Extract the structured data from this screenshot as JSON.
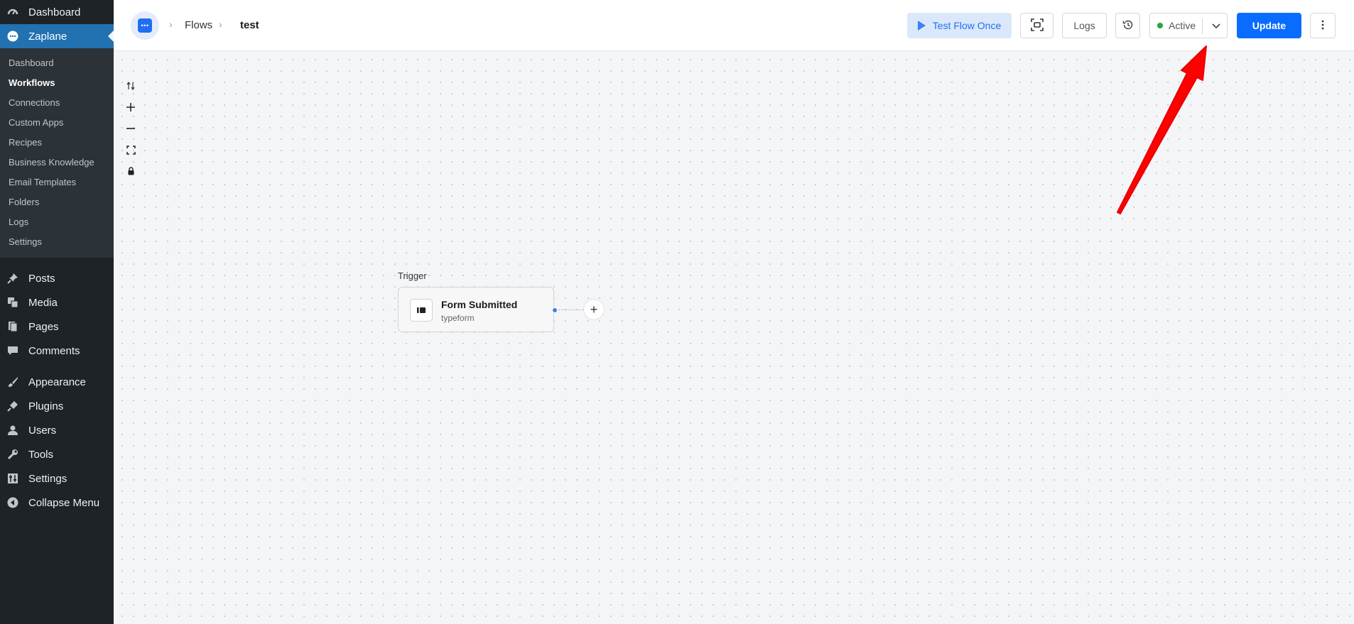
{
  "sidebar": {
    "top_item": "Dashboard",
    "current_plugin": "Zaplane",
    "submenu": [
      "Dashboard",
      "Workflows",
      "Connections",
      "Custom Apps",
      "Recipes",
      "Business Knowledge",
      "Email Templates",
      "Folders",
      "Logs",
      "Settings"
    ],
    "active_submenu": "Workflows",
    "menu": {
      "posts": "Posts",
      "media": "Media",
      "pages": "Pages",
      "comments": "Comments",
      "appearance": "Appearance",
      "plugins": "Plugins",
      "users": "Users",
      "tools": "Tools",
      "settings": "Settings",
      "collapse": "Collapse Menu"
    }
  },
  "header": {
    "breadcrumb": [
      "Flows",
      "test"
    ],
    "test_flow_label": "Test Flow Once",
    "logs_label": "Logs",
    "status_label": "Active",
    "status_color": "#22a447",
    "update_label": "Update",
    "accent_color": "#0a6cff"
  },
  "canvas": {
    "controls": [
      "swap-icon",
      "zoom-in-icon",
      "zoom-out-icon",
      "fit-view-icon",
      "lock-icon"
    ],
    "trigger_label": "Trigger",
    "node": {
      "title": "Form Submitted",
      "subtitle": "typeform"
    },
    "add_symbol": "+"
  },
  "annotation": {
    "arrow_color": "#ff0000"
  }
}
